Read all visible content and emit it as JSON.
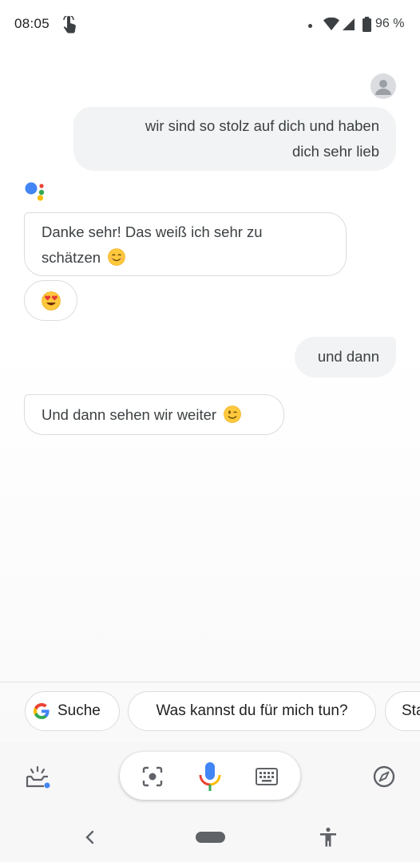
{
  "status_bar": {
    "time": "08:05",
    "battery": "96 %"
  },
  "chat": {
    "user_message_1": {
      "line1": "wir sind so stolz auf dich und haben",
      "line2": "dich sehr lieb"
    },
    "assistant_message_1": {
      "line1": "Danke sehr! Das weiß ich sehr zu",
      "line2": "schätzen"
    },
    "reaction_emoji": "heart-eyes-emoji",
    "user_message_2": "und dann",
    "assistant_message_2": "Und dann sehen wir weiter"
  },
  "suggestions": [
    {
      "label": "Suche",
      "icon": "google-g-icon"
    },
    {
      "label": "Was kannst du für mich tun?"
    },
    {
      "label": "Sta"
    }
  ],
  "bottom_bar": {
    "icons": [
      "updates-tray-icon",
      "lens-icon",
      "mic-icon",
      "keyboard-icon",
      "explore-compass-icon"
    ]
  },
  "nav_bar": {
    "icons": [
      "back-icon",
      "home-pill",
      "accessibility-icon"
    ]
  },
  "colors": {
    "google_blue": "#4285F4",
    "google_red": "#EA4335",
    "google_yellow": "#FBBC05",
    "google_green": "#34A853",
    "bubble_user": "#f1f3f4"
  }
}
